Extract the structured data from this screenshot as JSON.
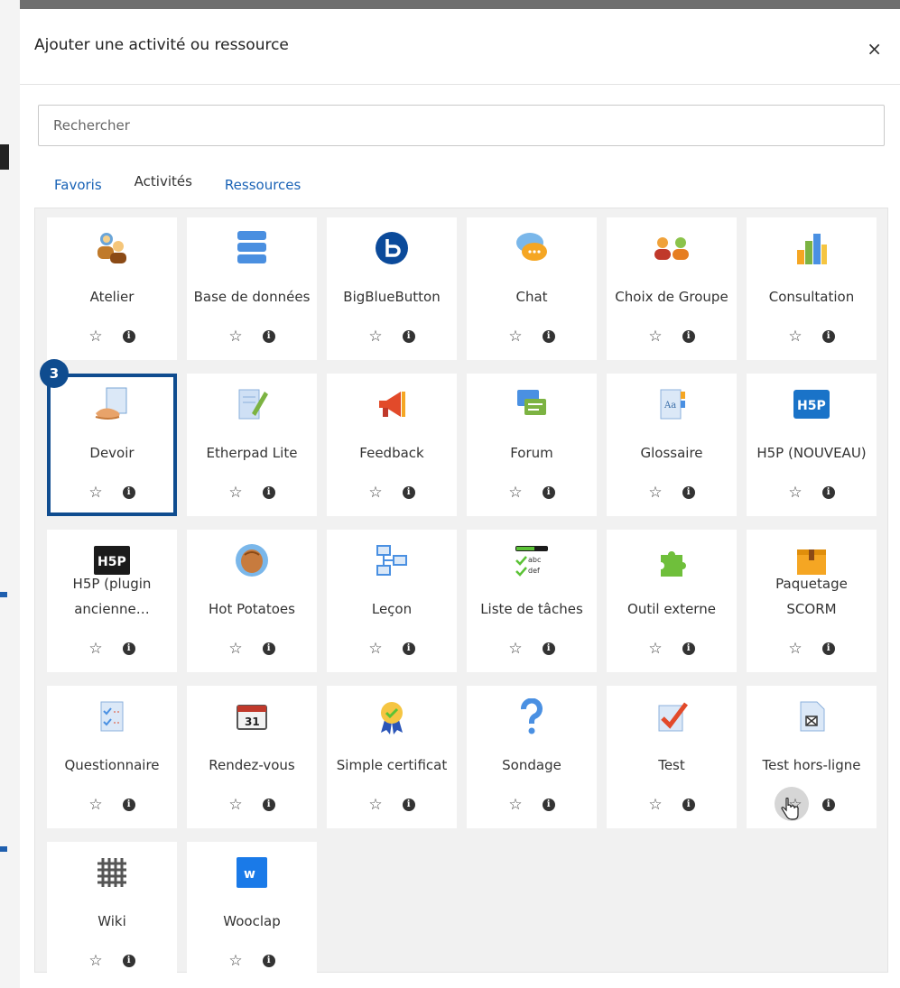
{
  "modal": {
    "title": "Ajouter une activité ou ressource",
    "close": "×",
    "search_placeholder": "Rechercher",
    "tabs": [
      {
        "label": "Favoris",
        "active": false
      },
      {
        "label": "Activités",
        "active": true
      },
      {
        "label": "Ressources",
        "active": false
      }
    ],
    "step_badge": "3",
    "items": [
      {
        "label": "Atelier",
        "icon": "atelier-icon"
      },
      {
        "label": "Base de données",
        "icon": "database-icon"
      },
      {
        "label": "BigBlueButton",
        "icon": "bigbluebutton-icon"
      },
      {
        "label": "Chat",
        "icon": "chat-icon"
      },
      {
        "label": "Choix de Groupe",
        "icon": "group-choice-icon"
      },
      {
        "label": "Consultation",
        "icon": "bar-chart-icon"
      },
      {
        "label": "Devoir",
        "icon": "assignment-icon"
      },
      {
        "label": "Etherpad Lite",
        "icon": "etherpad-icon"
      },
      {
        "label": "Feedback",
        "icon": "megaphone-icon"
      },
      {
        "label": "Forum",
        "icon": "forum-icon"
      },
      {
        "label": "Glossaire",
        "icon": "glossary-icon"
      },
      {
        "label": "H5P (NOUVEAU)",
        "icon": "h5p-icon"
      },
      {
        "label": "H5P (plugin ancienne…",
        "icon": "h5p-dark-icon"
      },
      {
        "label": "Hot Potatoes",
        "icon": "hot-potatoes-icon"
      },
      {
        "label": "Leçon",
        "icon": "lesson-icon"
      },
      {
        "label": "Liste de tâches",
        "icon": "checklist-icon"
      },
      {
        "label": "Outil externe",
        "icon": "puzzle-icon"
      },
      {
        "label": "Paquetage SCORM",
        "icon": "scorm-package-icon"
      },
      {
        "label": "Questionnaire",
        "icon": "questionnaire-icon"
      },
      {
        "label": "Rendez-vous",
        "icon": "calendar-icon"
      },
      {
        "label": "Simple certificat",
        "icon": "certificate-icon"
      },
      {
        "label": "Sondage",
        "icon": "question-mark-icon"
      },
      {
        "label": "Test",
        "icon": "quiz-check-icon"
      },
      {
        "label": "Test hors-ligne",
        "icon": "offline-quiz-icon"
      },
      {
        "label": "Wiki",
        "icon": "wiki-icon"
      },
      {
        "label": "Wooclap",
        "icon": "wooclap-icon"
      }
    ],
    "selected_item": "Devoir",
    "hovered_item": "Test hors-ligne",
    "accent_color": "#0f4c8f",
    "link_color": "#1a63b6"
  }
}
